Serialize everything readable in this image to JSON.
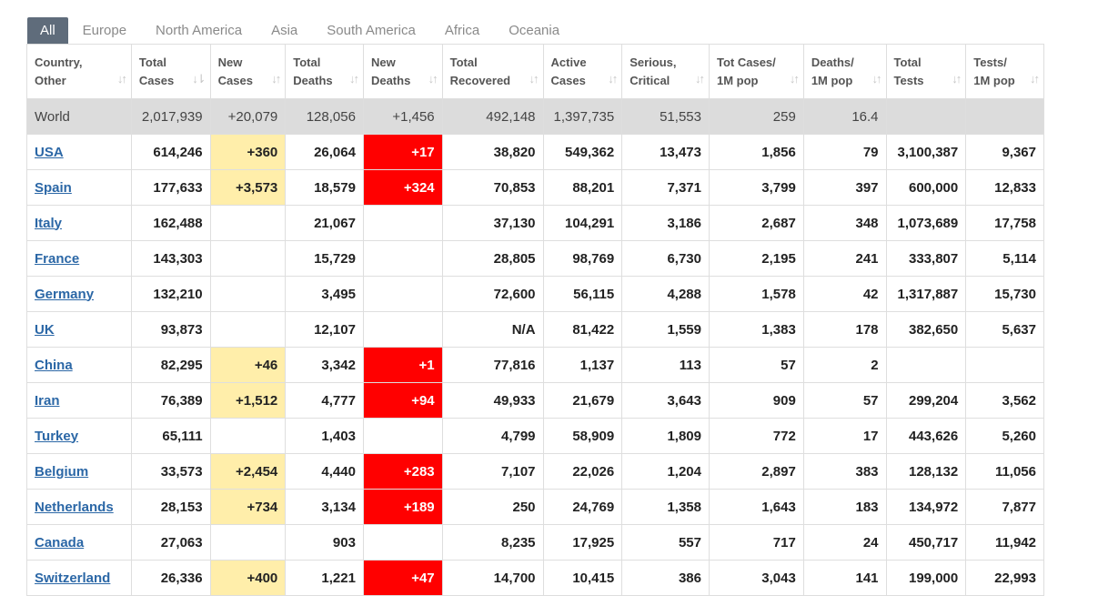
{
  "tabs": [
    "All",
    "Europe",
    "North America",
    "Asia",
    "South America",
    "Africa",
    "Oceania"
  ],
  "columns": [
    [
      "Country,",
      "Other"
    ],
    [
      "Total",
      "Cases"
    ],
    [
      "New",
      "Cases"
    ],
    [
      "Total",
      "Deaths"
    ],
    [
      "New",
      "Deaths"
    ],
    [
      "Total",
      "Recovered"
    ],
    [
      "Active",
      "Cases"
    ],
    [
      "Serious,",
      "Critical"
    ],
    [
      "Tot Cases/",
      "1M pop"
    ],
    [
      "Deaths/",
      "1M pop"
    ],
    [
      "Total",
      "Tests"
    ],
    [
      "Tests/",
      "1M pop"
    ]
  ],
  "world": [
    "World",
    "2,017,939",
    "+20,079",
    "128,056",
    "+1,456",
    "492,148",
    "1,397,735",
    "51,553",
    "259",
    "16.4",
    "",
    ""
  ],
  "rows": [
    [
      "USA",
      "614,246",
      "+360",
      "26,064",
      "+17",
      "38,820",
      "549,362",
      "13,473",
      "1,856",
      "79",
      "3,100,387",
      "9,367"
    ],
    [
      "Spain",
      "177,633",
      "+3,573",
      "18,579",
      "+324",
      "70,853",
      "88,201",
      "7,371",
      "3,799",
      "397",
      "600,000",
      "12,833"
    ],
    [
      "Italy",
      "162,488",
      "",
      "21,067",
      "",
      "37,130",
      "104,291",
      "3,186",
      "2,687",
      "348",
      "1,073,689",
      "17,758"
    ],
    [
      "France",
      "143,303",
      "",
      "15,729",
      "",
      "28,805",
      "98,769",
      "6,730",
      "2,195",
      "241",
      "333,807",
      "5,114"
    ],
    [
      "Germany",
      "132,210",
      "",
      "3,495",
      "",
      "72,600",
      "56,115",
      "4,288",
      "1,578",
      "42",
      "1,317,887",
      "15,730"
    ],
    [
      "UK",
      "93,873",
      "",
      "12,107",
      "",
      "N/A",
      "81,422",
      "1,559",
      "1,383",
      "178",
      "382,650",
      "5,637"
    ],
    [
      "China",
      "82,295",
      "+46",
      "3,342",
      "+1",
      "77,816",
      "1,137",
      "113",
      "57",
      "2",
      "",
      ""
    ],
    [
      "Iran",
      "76,389",
      "+1,512",
      "4,777",
      "+94",
      "49,933",
      "21,679",
      "3,643",
      "909",
      "57",
      "299,204",
      "3,562"
    ],
    [
      "Turkey",
      "65,111",
      "",
      "1,403",
      "",
      "4,799",
      "58,909",
      "1,809",
      "772",
      "17",
      "443,626",
      "5,260"
    ],
    [
      "Belgium",
      "33,573",
      "+2,454",
      "4,440",
      "+283",
      "7,107",
      "22,026",
      "1,204",
      "2,897",
      "383",
      "128,132",
      "11,056"
    ],
    [
      "Netherlands",
      "28,153",
      "+734",
      "3,134",
      "+189",
      "250",
      "24,769",
      "1,358",
      "1,643",
      "183",
      "134,972",
      "7,877"
    ],
    [
      "Canada",
      "27,063",
      "",
      "903",
      "",
      "8,235",
      "17,925",
      "557",
      "717",
      "24",
      "450,717",
      "11,942"
    ],
    [
      "Switzerland",
      "26,336",
      "+400",
      "1,221",
      "+47",
      "14,700",
      "10,415",
      "386",
      "3,043",
      "141",
      "199,000",
      "22,993"
    ]
  ],
  "colors": {
    "new_cases_bg": "#ffeeaa",
    "new_deaths_bg": "#ff0000",
    "world_bg": "#dcdcdc",
    "link": "#2b67a6",
    "active_tab": "#5f6c7b"
  },
  "icons": {
    "sort": "sort-arrows-icon",
    "sort_active": "sort-desc-icon"
  }
}
